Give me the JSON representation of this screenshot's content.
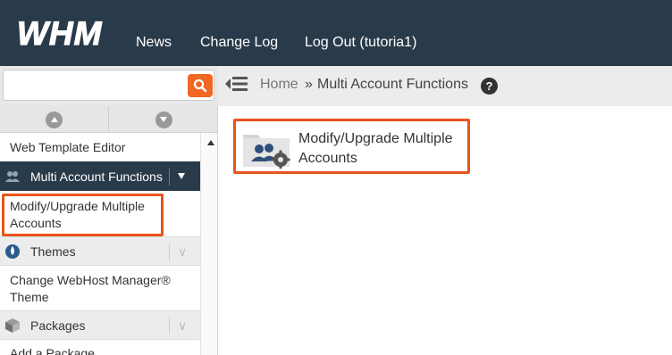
{
  "header": {
    "logo_text": "WHM",
    "nav": [
      {
        "label": "News"
      },
      {
        "label": "Change Log"
      },
      {
        "label": "Log Out (tutoria1)"
      }
    ]
  },
  "search": {
    "value": "",
    "placeholder": "",
    "icon": "search-icon"
  },
  "breadcrumb": {
    "home": "Home",
    "separator": "»",
    "current": "Multi Account Functions",
    "help": "?"
  },
  "sidebar": {
    "items": [
      {
        "label": "Web Template Editor"
      },
      {
        "label": "Multi Account Functions",
        "type": "category",
        "active": true,
        "icon": "users-icon"
      },
      {
        "label": "Modify/Upgrade Multiple Accounts",
        "highlighted": true
      },
      {
        "label": "Themes",
        "type": "category",
        "icon": "themes-icon"
      },
      {
        "label": "Change WebHost Manager® Theme"
      },
      {
        "label": "Packages",
        "type": "category",
        "icon": "packages-icon"
      },
      {
        "label": "Add a Package"
      }
    ]
  },
  "main": {
    "features": [
      {
        "label": "Modify/Upgrade Multiple Accounts",
        "icon": "modify-accounts-icon"
      }
    ]
  },
  "colors": {
    "header_bg": "#293a4a",
    "accent": "#f26722",
    "highlight_border": "#e8541c"
  }
}
